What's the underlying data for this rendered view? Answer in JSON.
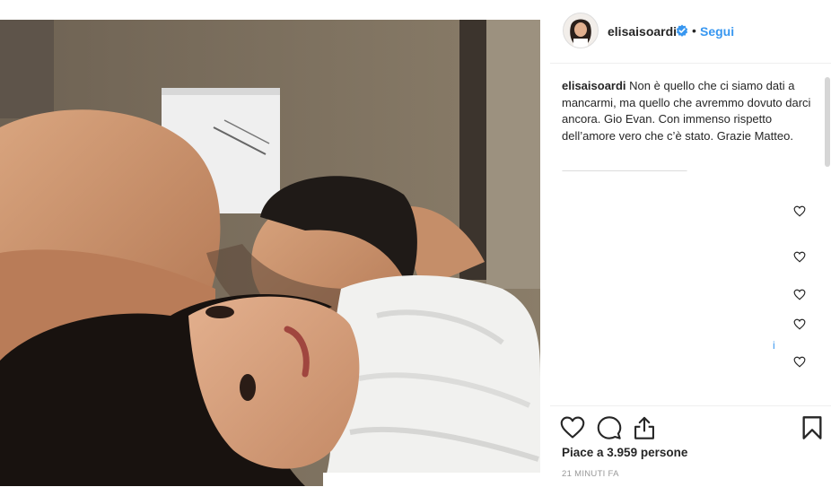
{
  "post": {
    "image_alt": "Selfie di coppia a letto"
  },
  "header": {
    "username": "elisaisoardi",
    "verified_icon": "verified-badge-icon",
    "separator": "•",
    "follow_label": "Segui"
  },
  "caption": {
    "username": "elisaisoardi",
    "text": "Non è quello che ci siamo dati a mancarmi, ma quello che avremmo dovuto darci ancora. Gio Evan. Con immenso rispetto dell’amore vero che c’è stato. Grazie Matteo."
  },
  "comments_like_icon": "heart-outline-icon",
  "scroll_marker": "i",
  "actions": {
    "like_icon": "heart-icon",
    "comment_icon": "comment-bubble-icon",
    "share_icon": "share-upload-icon",
    "save_icon": "bookmark-icon"
  },
  "likes_text": "Piace a 3.959 persone",
  "timestamp": "21 MINUTI FA",
  "colors": {
    "link_blue": "#3897f0",
    "border": "#efefef",
    "text": "#262626",
    "muted": "#999999"
  }
}
